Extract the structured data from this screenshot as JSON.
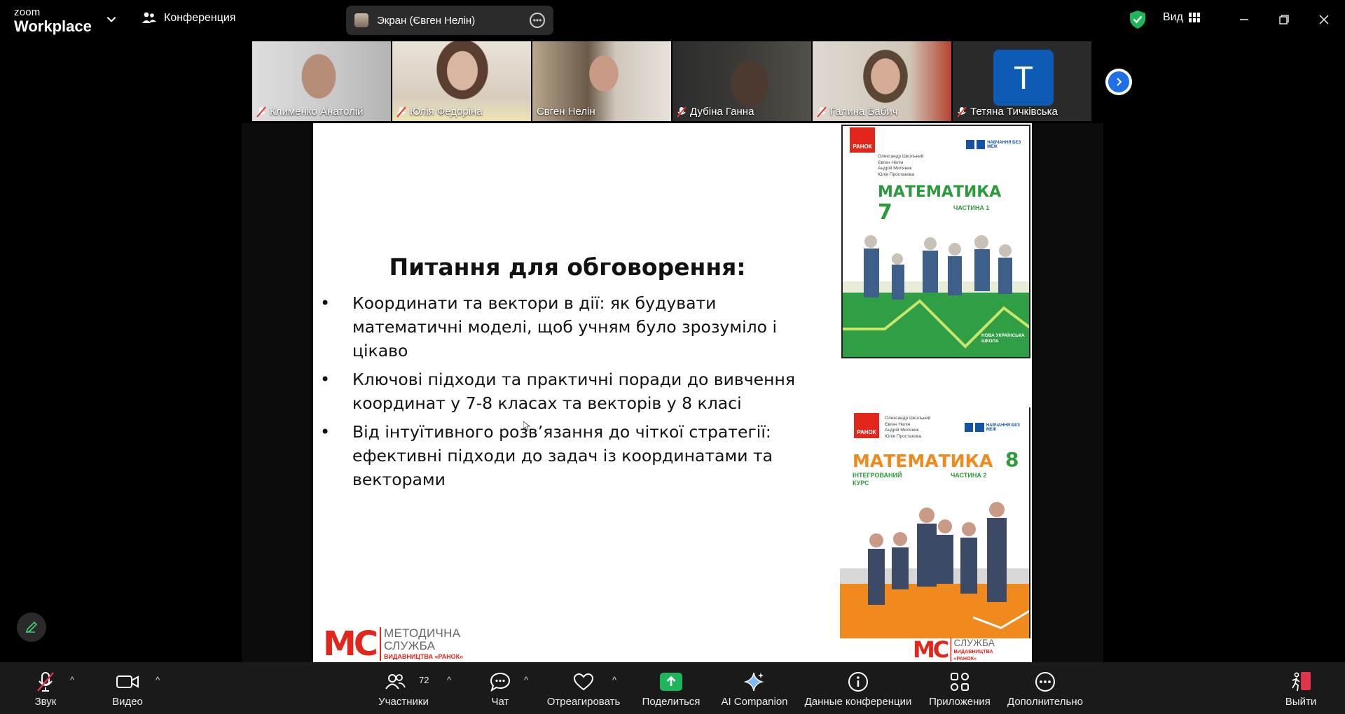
{
  "top": {
    "brand_small": "zoom",
    "brand_big": "Workplace",
    "meeting_title": "Конференция",
    "share_label": "Экран (Євген Нелін)",
    "view_label": "Вид"
  },
  "participants": [
    {
      "name": "Клименко Анатолій",
      "muted": true
    },
    {
      "name": "Юлія Федоріна",
      "muted": true
    },
    {
      "name": "Євген Нелін",
      "muted": false,
      "active": true
    },
    {
      "name": "Дубіна Ганна",
      "muted": true
    },
    {
      "name": "Галина Бабич",
      "muted": true
    },
    {
      "name": "Тетяна Тичківська",
      "muted": true,
      "initial": "T"
    }
  ],
  "slide": {
    "title": "Питання для обговорення:",
    "bullets": [
      "Координати та вектори в дії: як будувати математичні моделі, щоб учням було зрозуміло і цікаво",
      "Ключові підходи та практичні поради до вивчення координат у 7-8 класах та векторів у 8 класі",
      "Від інтуїтивного розв’язання до чіткої стратегії: ефективні підходи до задач із координатами та векторами"
    ],
    "book1": {
      "publisher": "РАНОК",
      "authors": [
        "Олександр Школьний",
        "Євген Нелін",
        "Андрій Миляник",
        "Юлія Простакова"
      ],
      "badge": "НАВЧАННЯ БЕЗ МЕЖ",
      "title": "МАТЕМАТИКА",
      "grade": "7",
      "part": "ЧАСТИНА 1",
      "series": "НОВА УКРАЇНСЬКА ШКОЛА"
    },
    "book2": {
      "publisher": "РАНОК",
      "authors": [
        "Олександр Школьний",
        "Євген Нелін",
        "Андрій Миляник",
        "Юлія Простакова"
      ],
      "badge": "НАВЧАННЯ БЕЗ МЕЖ",
      "title": "МАТЕМАТИКА",
      "grade": "8",
      "course": "ІНТЕГРОВАНИЙ КУРС",
      "part": "ЧАСТИНА 2"
    },
    "logo_line1": "МЕТОДИЧНА",
    "logo_line2": "СЛУЖБА",
    "logo_line3": "ВИДАВНИЦТВА «РАНОК»"
  },
  "toolbar": {
    "audio": "Звук",
    "video": "Видео",
    "participants": "Участники",
    "participants_count": "72",
    "chat": "Чат",
    "react": "Отреагировать",
    "share": "Поделиться",
    "ai": "AI Companion",
    "info": "Данные конференции",
    "apps": "Приложения",
    "more": "Дополнительно",
    "leave": "Выйти"
  },
  "colors": {
    "accent_green": "#24d06e",
    "share_green": "#1fb55b",
    "leave_red": "#e0344a",
    "book_green": "#2b9b3c",
    "book_orange": "#f08a1c"
  }
}
